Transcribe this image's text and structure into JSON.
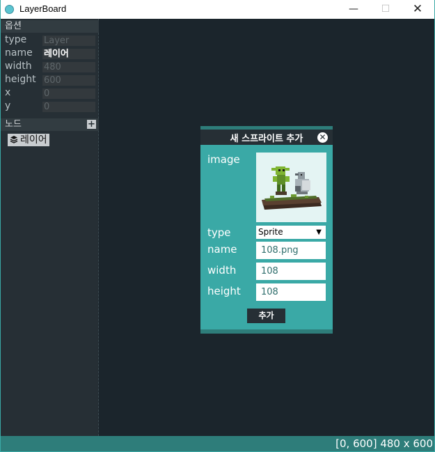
{
  "window": {
    "title": "LayerBoard",
    "min_glyph": "—",
    "max_glyph": "☐",
    "close_glyph": "✕"
  },
  "sidebar": {
    "options_header": "옵션",
    "properties": [
      {
        "label": "type",
        "value": "Layer"
      },
      {
        "label": "name",
        "value": "레이어"
      },
      {
        "label": "width",
        "value": "480"
      },
      {
        "label": "height",
        "value": "600"
      },
      {
        "label": "x",
        "value": "0"
      },
      {
        "label": "y",
        "value": "0"
      }
    ],
    "nodes_header": "노드",
    "add_node_glyph": "+",
    "layer_node_label": "레이어"
  },
  "status": {
    "text": "[0, 600] 480 x 600"
  },
  "dialog": {
    "title": "새 스프라이트 추가",
    "close_glyph": "✕",
    "image_label": "image",
    "type_label": "type",
    "type_value": "Sprite",
    "name_label": "name",
    "name_value": "108.png",
    "width_label": "width",
    "width_value": "108",
    "height_label": "height",
    "height_value": "108",
    "add_button_label": "추가"
  }
}
